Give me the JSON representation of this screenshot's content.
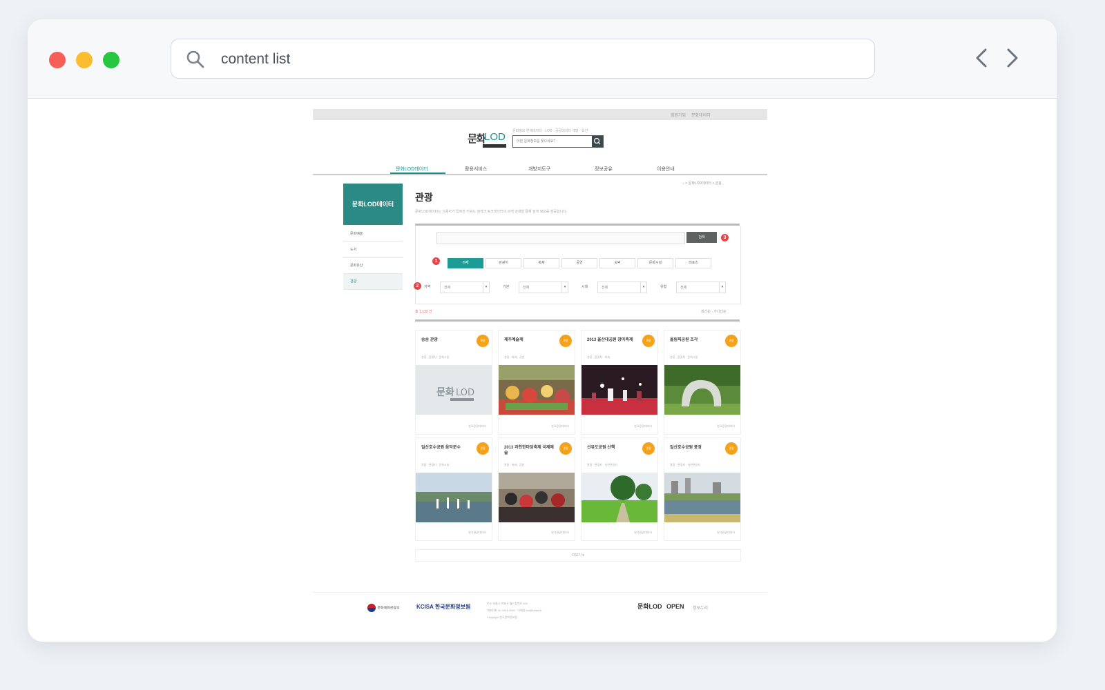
{
  "browser": {
    "address": "content list",
    "traffic_lights": [
      "#f55f57",
      "#fbbd2e",
      "#27c840"
    ],
    "back_icon": "chevron-left-icon",
    "forward_icon": "chevron-right-icon",
    "search_icon": "search-icon"
  },
  "page": {
    "util_links": [
      "회원가입",
      "문화데이터"
    ],
    "logo": {
      "part1": "문화",
      "part2": "LOD"
    },
    "header_tagline": "문화정보 연계데이터 · LOD · 공공데이터 개방 · 보건",
    "header_search_placeholder": "어떤 문화정보를 찾으세요?",
    "gnb": [
      "문화LOD데이터",
      "활용서비스",
      "개방지도구",
      "정보공유",
      "이용안내"
    ],
    "lnb": {
      "head": "문화LOD데이터",
      "items": [
        "문화예술",
        "도서",
        "문화유산",
        "관광"
      ]
    },
    "breadcrumb": "⌂ > 문화LOD데이터 > 관광",
    "title": "관광",
    "description": "문화LOD데이터는 사용자가 입력한 키워드 검색과 링크데이터의 관계 검색을 통해 검색 정보를 제공합니다.",
    "search_button": "검색",
    "badges": [
      "3",
      "1",
      "2"
    ],
    "tabs": [
      "전체",
      "관광지",
      "축제",
      "공연",
      "숙박",
      "문화시설",
      "레포츠"
    ],
    "selects": [
      {
        "label": "지역",
        "value": "전체"
      },
      {
        "label": "기관",
        "value": "전체"
      },
      {
        "label": "시대",
        "value": "전체"
      },
      {
        "label": "유형",
        "value": "전체"
      }
    ],
    "list_count": "총 1,132 건",
    "sort_options": "최신순 · 가나다순",
    "cards": [
      {
        "title": "송송 관광",
        "category": "관광 · 관광지 · 문화시설",
        "source": "한국관광데이터",
        "badge": "관광"
      },
      {
        "title": "제주예술제",
        "category": "관광 · 축제 · 공연",
        "source": "한국관광데이터",
        "badge": "관광"
      },
      {
        "title": "2013 울산대공원 장미축제",
        "category": "관광 · 관광지 · 축제",
        "source": "한국관광데이터",
        "badge": "관광"
      },
      {
        "title": "올림픽공원 조각",
        "category": "관광 · 관광지 · 문화시설",
        "source": "한국관광데이터",
        "badge": "관광"
      },
      {
        "title": "일산호수공원 음악분수",
        "category": "관광 · 관광지 · 문화시설",
        "source": "한국관광데이터",
        "badge": "관광"
      },
      {
        "title": "2013 과천한마당축제 국제예술",
        "category": "관광 · 축제 · 공연",
        "source": "한국관광데이터",
        "badge": "관광"
      },
      {
        "title": "선유도공원 산책",
        "category": "관광 · 관광지 · 자연관광지",
        "source": "한국관광데이터",
        "badge": "관광"
      },
      {
        "title": "일산호수공원 풍경",
        "category": "관광 · 관광지 · 자연관광지",
        "source": "한국관광데이터",
        "badge": "관광"
      }
    ],
    "more_label": "더보기 ▾",
    "footer": {
      "lines": [
        "주소 서울시 마포구 월드컵북로 400",
        "대표전화 02-3153-2000 · 이메일 lod@kcisa.kr",
        "Copyright 한국문화정보원"
      ],
      "logos": [
        "문화체육관광부",
        "KCISA 한국문화정보원",
        "문화LOD",
        "OPEN",
        "정보누리"
      ]
    }
  }
}
